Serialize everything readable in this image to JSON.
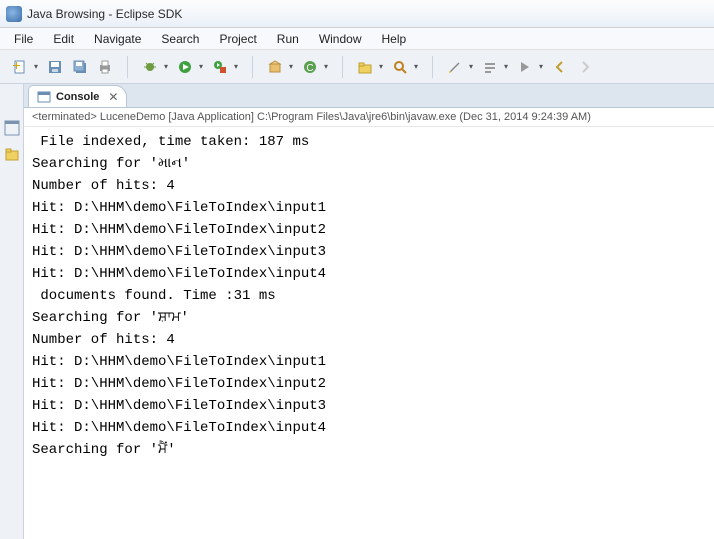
{
  "window": {
    "title": "Java Browsing - Eclipse SDK"
  },
  "menu": {
    "items": [
      "File",
      "Edit",
      "Navigate",
      "Search",
      "Project",
      "Run",
      "Window",
      "Help"
    ]
  },
  "tab": {
    "label": "Console",
    "close": "✕"
  },
  "console": {
    "status_prefix": "<terminated> ",
    "status": "LuceneDemo [Java Application] C:\\Program Files\\Java\\jre6\\bin\\javaw.exe (Dec 31, 2014 9:24:39 AM)",
    "lines": [
      " File indexed, time taken: 187 ms",
      "Searching for 'માન'",
      "Number of hits: 4",
      "Hit: D:\\HHM\\demo\\FileToIndex\\input1",
      "Hit: D:\\HHM\\demo\\FileToIndex\\input2",
      "Hit: D:\\HHM\\demo\\FileToIndex\\input3",
      "Hit: D:\\HHM\\demo\\FileToIndex\\input4",
      " documents found. Time :31 ms",
      "Searching for 'ਸ਼ਾਮ'",
      "Number of hits: 4",
      "Hit: D:\\HHM\\demo\\FileToIndex\\input1",
      "Hit: D:\\HHM\\demo\\FileToIndex\\input2",
      "Hit: D:\\HHM\\demo\\FileToIndex\\input3",
      "Hit: D:\\HHM\\demo\\FileToIndex\\input4",
      "Searching for 'ਮੈਂ'"
    ]
  }
}
